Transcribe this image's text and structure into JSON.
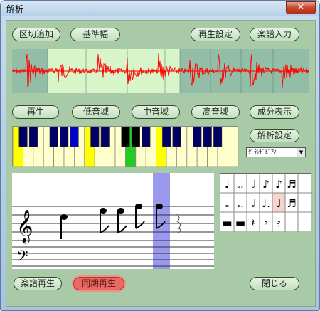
{
  "window": {
    "title": "解析",
    "close_glyph": "✕"
  },
  "buttons": {
    "segment_add": "区切追加",
    "reference_width": "基準幅",
    "playback_settings": "再生設定",
    "score_input": "楽譜入力",
    "play": "再生",
    "low_range": "低音域",
    "mid_range": "中音域",
    "high_range": "高音域",
    "component_display": "成分表示",
    "analysis_settings": "解析設定",
    "score_play": "楽譜再生",
    "sync_play": "同期再生",
    "close": "閉じる"
  },
  "instrument_select": {
    "value": "ｸﾞﾗﾝﾄﾞﾋﾟｱﾉ"
  },
  "colors": {
    "waveform": "#ff0000",
    "wave_unselected": "#93bda6",
    "wave_selected": "#d7f5c9",
    "key_highlight_yellow": "#ffff00",
    "key_active_green": "#22cc22",
    "black_key_dark_blue": "#000066",
    "black_key_blue": "#0000cc",
    "score_cursor": "#9999ee",
    "sync_button": "#e86b63"
  },
  "score": {
    "cursor_position_note": 5,
    "treble_clef": "𝄞",
    "bass_clef": "𝄢"
  },
  "note_palette": {
    "icons": [
      "quarter-note",
      "dotted-half-note",
      "half-note",
      "eighth-note",
      "eighth-note",
      "sixteenth-note",
      "whole-note",
      "dotted-half-note",
      "half-note",
      "dotted-quarter-note",
      "quarter-note",
      "sixteenth-note",
      "whole-rest",
      "half-rest",
      "quarter-rest",
      "eighth-rest",
      "sixteenth-rest"
    ],
    "selected_index": 10
  }
}
